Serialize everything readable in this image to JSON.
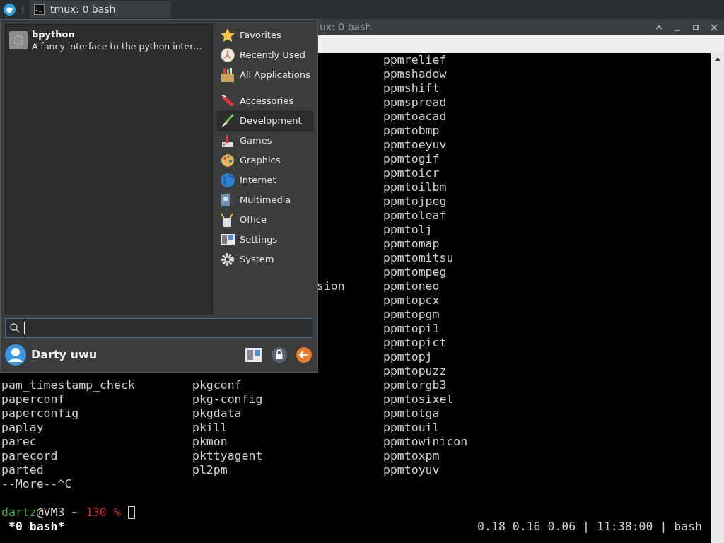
{
  "panel": {
    "task": {
      "title": "tmux: 0 bash",
      "selected": true
    }
  },
  "window": {
    "title": "ux: 0 bash"
  },
  "terminal": {
    "rows": [
      {
        "c3": "ppmrelief"
      },
      {
        "c3": "ppmshadow"
      },
      {
        "c3": "ppmshift"
      },
      {
        "c3": "ppmspread"
      },
      {
        "c3": "ppmtoacad"
      },
      {
        "c3": "ppmtobmp"
      },
      {
        "c3": "ppmtoeyuv"
      },
      {
        "c3": "ppmtogif"
      },
      {
        "c3": "ppmtoicr"
      },
      {
        "c3": "ppmtoilbm"
      },
      {
        "c3": "ppmtojpeg"
      },
      {
        "c3": "ppmtoleaf"
      },
      {
        "c3": "ppmtolj"
      },
      {
        "c3": "ppmtomap"
      },
      {
        "c3": "ppmtomitsu"
      },
      {
        "c3": "ppmtompeg"
      },
      {
        "c2": "sion",
        "c3": "ppmtoneo"
      },
      {
        "c3": "ppmtopcx"
      },
      {
        "c3": "ppmtopgm"
      },
      {
        "c3": "ppmtopi1"
      },
      {
        "c3": "ppmtopict"
      },
      {
        "c3": "ppmtopj"
      },
      {
        "c3": "ppmtopuzz"
      },
      {
        "c1": "pam_timestamp_check",
        "c2": "pkgconf",
        "c3": "ppmtorgb3"
      },
      {
        "c1": "paperconf",
        "c2": "pkg-config",
        "c3": "ppmtosixel"
      },
      {
        "c1": "paperconfig",
        "c2": "pkgdata",
        "c3": "ppmtotga"
      },
      {
        "c1": "paplay",
        "c2": "pkill",
        "c3": "ppmtouil"
      },
      {
        "c1": "parec",
        "c2": "pkmon",
        "c3": "ppmtowinicon"
      },
      {
        "c1": "parecord",
        "c2": "pkttyagent",
        "c3": "ppmtoxpm"
      },
      {
        "c1": "parted",
        "c2": "pl2pm",
        "c3": "ppmtoyuv"
      }
    ],
    "more": "--More--^C",
    "prompt": {
      "user": "dartz",
      "host": "@VM3 ~ ",
      "code": "130 %"
    },
    "status": {
      "left": "*0 bash*",
      "right": "0.18 0.16 0.06 | 11:38:00 | bash"
    }
  },
  "menu": {
    "result": {
      "name": "bpython",
      "description": "A fancy interface to the python inter…"
    },
    "categories": [
      {
        "label": "Favorites",
        "selected": false
      },
      {
        "label": "Recently Used",
        "selected": false
      },
      {
        "label": "All Applications",
        "selected": false
      },
      {
        "label": "Accessories",
        "selected": false
      },
      {
        "label": "Development",
        "selected": true
      },
      {
        "label": "Games",
        "selected": false
      },
      {
        "label": "Graphics",
        "selected": false
      },
      {
        "label": "Internet",
        "selected": false
      },
      {
        "label": "Multimedia",
        "selected": false
      },
      {
        "label": "Office",
        "selected": false
      },
      {
        "label": "Settings",
        "selected": false
      },
      {
        "label": "System",
        "selected": false
      }
    ],
    "user": "Darty uwu"
  }
}
